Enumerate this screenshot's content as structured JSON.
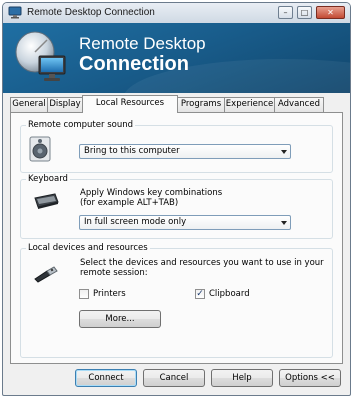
{
  "window": {
    "title": "Remote Desktop Connection",
    "banner_line1": "Remote Desktop",
    "banner_line2": "Connection"
  },
  "tabs": [
    {
      "label": "General",
      "active": false
    },
    {
      "label": "Display",
      "active": false
    },
    {
      "label": "Local Resources",
      "active": true
    },
    {
      "label": "Programs",
      "active": false
    },
    {
      "label": "Experience",
      "active": false
    },
    {
      "label": "Advanced",
      "active": false
    }
  ],
  "sound": {
    "group_label": "Remote computer sound",
    "selected": "Bring to this computer",
    "icon": "speaker-icon"
  },
  "keyboard": {
    "group_label": "Keyboard",
    "description_line1": "Apply Windows key combinations",
    "description_line2": "(for example ALT+TAB)",
    "selected": "In full screen mode only",
    "icon": "keyboard-icon"
  },
  "devices": {
    "group_label": "Local devices and resources",
    "description_line1": "Select the devices and resources you want to use in your",
    "description_line2": "remote session:",
    "printers_label": "Printers",
    "printers_checked": false,
    "clipboard_label": "Clipboard",
    "clipboard_checked": true,
    "more_label": "More...",
    "icon": "usb-plug-icon"
  },
  "footer": {
    "connect": "Connect",
    "cancel": "Cancel",
    "help": "Help",
    "options": "Options <<"
  },
  "colors": {
    "banner": "#195d8c",
    "close_button": "#c24a34"
  }
}
